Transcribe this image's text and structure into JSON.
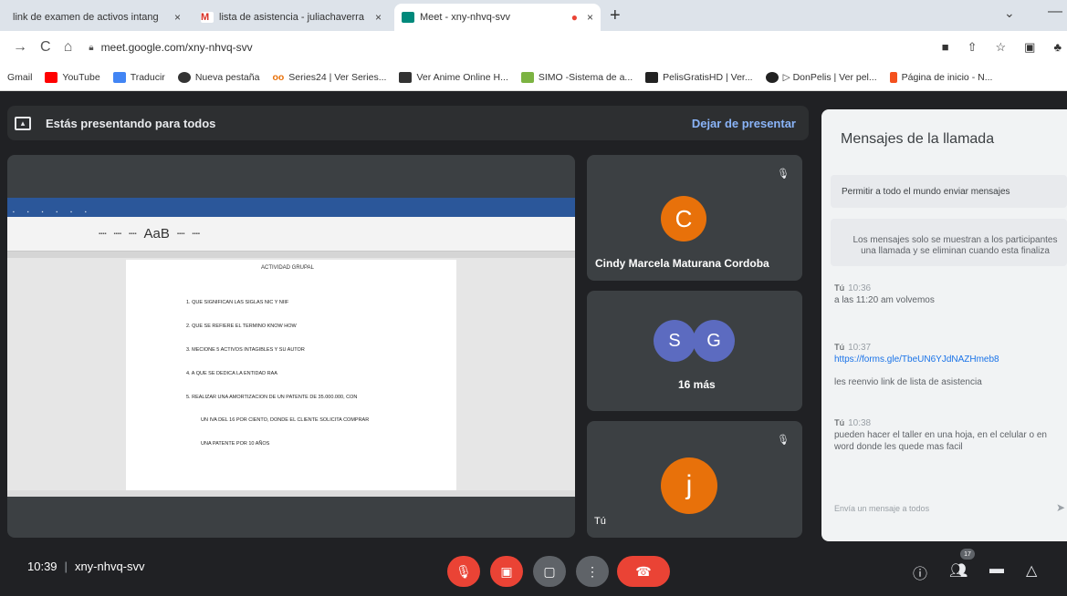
{
  "browser": {
    "tabs": [
      {
        "title": "link de examen de activos intang",
        "close": "×"
      },
      {
        "title": "lista de asistencia - juliachaverra",
        "close": "×"
      },
      {
        "title": "Meet - xny-nhvq-svv",
        "close": "×"
      }
    ],
    "url": "meet.google.com/xny-nhvq-svv",
    "bookmarks": [
      "Gmail",
      "YouTube",
      "Traducir",
      "Nueva pestaña",
      "Series24 | Ver Series...",
      "Ver Anime Online H...",
      "SIMO -Sistema de a...",
      "PelisGratisHD | Ver...",
      "▷ DonPelis | Ver pel...",
      "Página de inicio - N..."
    ]
  },
  "meet": {
    "presenting_text": "Estás presentando para todos",
    "stop_presenting": "Dejar de presentar",
    "meeting_time": "10:39",
    "meeting_code": "xny-nhvq-svv",
    "participants_count": "17"
  },
  "document": {
    "title": "ACTIVIDAD GRUPAL",
    "ribbon_sample": "AaB",
    "questions": [
      "1. QUE SIGNIFICAN LAS SIGLAS NIC Y NIIF",
      "2. QUE SE REFIERE EL TERMINO KNOW HOW",
      "3. MECIONE 5 ACTIVOS INTAGIBLES Y SU AUTOR",
      "4. A QUE SE DEDICA LA ENTIDAD RAA",
      "5. REALIZAR UNA AMORTIZACION DE UN PATENTE DE 35.000.000, CON",
      "UN IVA DEL 16 POR CIENTO, DONDE EL CLIENTE SOLICITA COMPRAR",
      "UNA PATENTE POR 10 AÑOS"
    ]
  },
  "participants": {
    "tile1": {
      "initial": "C",
      "name": "Cindy Marcela Maturana Cordoba"
    },
    "tile2": {
      "initial_1": "S",
      "initial_2": "G",
      "label": "16 más"
    },
    "tile3": {
      "initial": "j",
      "name": "Tú"
    }
  },
  "chat": {
    "title": "Mensajes de la llamada",
    "permit_label": "Permitir a todo el mundo enviar mensajes",
    "notice_line1": "Los mensajes solo se muestran a los participantes",
    "notice_line2": "una llamada y se eliminan cuando esta finaliza",
    "messages": [
      {
        "sender": "Tú",
        "time": "10:36",
        "text": "a las 11:20 am volvemos"
      },
      {
        "sender": "Tú",
        "time": "10:37",
        "link": "https://forms.gle/TbeUN6YJdNAZHmeb8",
        "text": "les reenvio link de lista de asistencia"
      },
      {
        "sender": "Tú",
        "time": "10:38",
        "text": "pueden hacer el taller en una hoja, en el celular o en",
        "text2": "word donde les quede mas facil"
      }
    ],
    "input_placeholder": "Envía un mensaje a todos"
  },
  "colors": {
    "accent": "#8ab4f8",
    "danger": "#ea4335",
    "avatar_orange": "#e8710a",
    "avatar_indigo": "#5c6bc0"
  }
}
